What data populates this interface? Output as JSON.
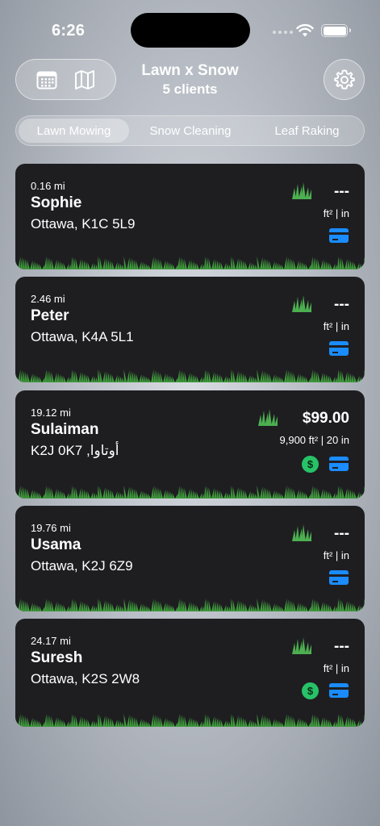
{
  "status": {
    "time": "6:26"
  },
  "header": {
    "title": "Lawn x Snow",
    "subtitle": "5 clients"
  },
  "tabs": [
    {
      "label": "Lawn Mowing",
      "active": true
    },
    {
      "label": "Snow Cleaning",
      "active": false
    },
    {
      "label": "Leaf Raking",
      "active": false
    }
  ],
  "clients": [
    {
      "distance": "0.16 mi",
      "name": "Sophie",
      "address": "Ottawa, K1C 5L9",
      "price": "---",
      "dims": "ft² |  in",
      "paid": false
    },
    {
      "distance": "2.46 mi",
      "name": "Peter",
      "address": "Ottawa, K4A 5L1",
      "price": "---",
      "dims": "ft² |  in",
      "paid": false
    },
    {
      "distance": "19.12 mi",
      "name": "Sulaiman",
      "address": "K2J 0K7 ,أوتاوا",
      "price": "$99.00",
      "dims": "9,900 ft² | 20 in",
      "paid": true
    },
    {
      "distance": "19.76 mi",
      "name": "Usama",
      "address": "Ottawa, K2J 6Z9",
      "price": "---",
      "dims": "ft² |  in",
      "paid": false
    },
    {
      "distance": "24.17 mi",
      "name": "Suresh",
      "address": "Ottawa, K2S 2W8",
      "price": "---",
      "dims": "ft² |  in",
      "paid": true
    }
  ],
  "icons": {
    "calendar": "calendar-icon",
    "map": "map-icon",
    "settings": "gear-icon",
    "grass": "grass-icon",
    "card": "credit-card-icon",
    "dollar": "dollar-icon",
    "dollar_glyph": "$"
  },
  "colors": {
    "accent": "#1a8cff",
    "paid_green": "#27c267",
    "grass_green": "#3f9a3c",
    "card_bg": "#1e1e21"
  }
}
